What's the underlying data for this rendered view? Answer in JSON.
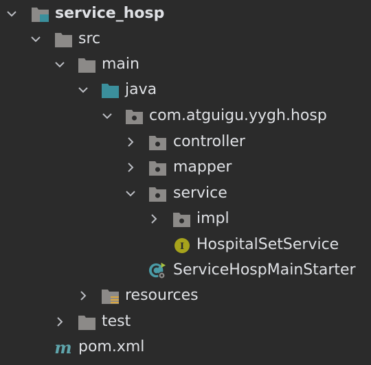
{
  "colors": {
    "background": "#2b2b2b",
    "text": "#dfe1e5",
    "chevron": "#bcbec4",
    "folder": "#8c8a88",
    "folder_source": "#3b8f9c",
    "interface_badge": "#a7a31c",
    "spring_icon": "#4a9ba6",
    "maven": "#5fa5ac",
    "resources_marker": "#d9a743"
  },
  "tree": {
    "items": [
      {
        "label": "service_hosp",
        "icon": "module-folder-icon",
        "expanded": true
      },
      {
        "label": "src",
        "icon": "folder-icon",
        "expanded": true
      },
      {
        "label": "main",
        "icon": "folder-icon",
        "expanded": true
      },
      {
        "label": "java",
        "icon": "source-folder-icon",
        "expanded": true
      },
      {
        "label": "com.atguigu.yygh.hosp",
        "icon": "package-icon",
        "expanded": true
      },
      {
        "label": "controller",
        "icon": "package-icon",
        "expanded": false
      },
      {
        "label": "mapper",
        "icon": "package-icon",
        "expanded": false
      },
      {
        "label": "service",
        "icon": "package-icon",
        "expanded": true
      },
      {
        "label": "impl",
        "icon": "package-icon",
        "expanded": false
      },
      {
        "label": "HospitalSetService",
        "icon": "interface-icon",
        "badge": "I"
      },
      {
        "label": "ServiceHospMainStarter",
        "icon": "spring-boot-class-icon"
      },
      {
        "label": "resources",
        "icon": "resources-folder-icon",
        "expanded": false
      },
      {
        "label": "test",
        "icon": "folder-icon",
        "expanded": false
      },
      {
        "label": "pom.xml",
        "icon": "maven-icon",
        "badge": "m"
      }
    ]
  }
}
